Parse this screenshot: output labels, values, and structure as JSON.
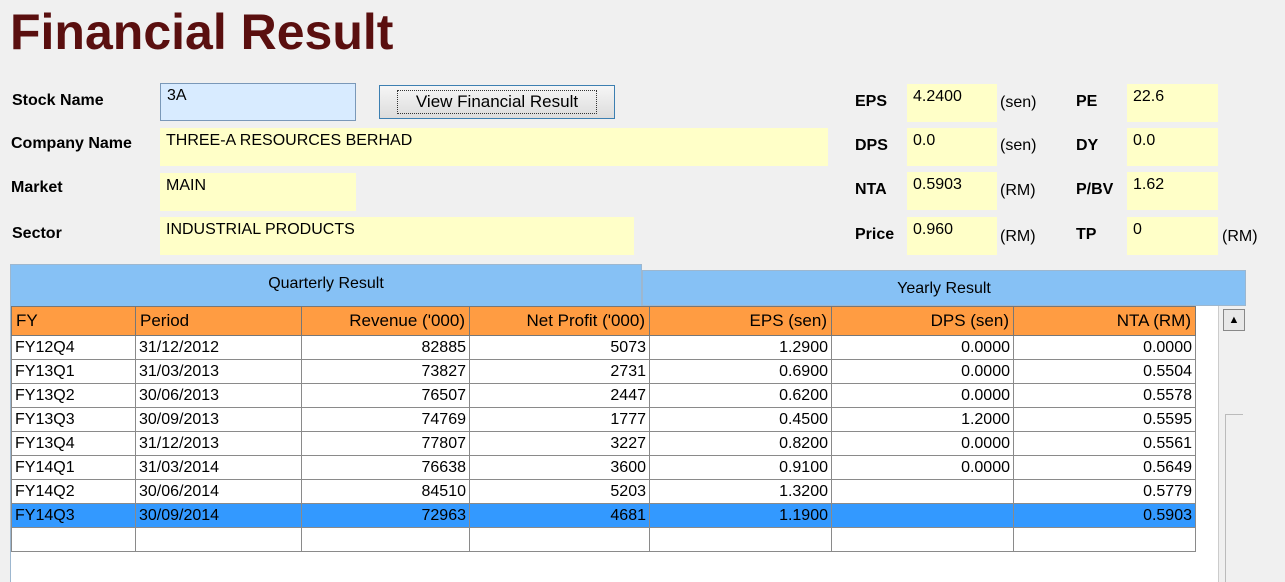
{
  "page": {
    "title": "Financial Result"
  },
  "form": {
    "stock_name_label": "Stock Name",
    "stock_name_value": "3A",
    "view_button": "View Financial Result",
    "company_name_label": "Company Name",
    "company_name_value": "THREE-A RESOURCES BERHAD",
    "market_label": "Market",
    "market_value": "MAIN",
    "sector_label": "Sector",
    "sector_value": "INDUSTRIAL PRODUCTS"
  },
  "metrics": {
    "eps_label": "EPS",
    "eps_value": "4.2400",
    "eps_unit": "(sen)",
    "dps_label": "DPS",
    "dps_value": "0.0",
    "dps_unit": "(sen)",
    "nta_label": "NTA",
    "nta_value": "0.5903",
    "nta_unit": "(RM)",
    "price_label": "Price",
    "price_value": "0.960",
    "price_unit": "(RM)",
    "pe_label": "PE",
    "pe_value": "22.6",
    "dy_label": "DY",
    "dy_value": "0.0",
    "pbv_label": "P/BV",
    "pbv_value": "1.62",
    "tp_label": "TP",
    "tp_value": "0",
    "tp_unit": "(RM)"
  },
  "tabs": {
    "quarterly": "Quarterly Result",
    "yearly": "Yearly Result"
  },
  "table": {
    "headers": [
      "FY",
      "Period",
      "Revenue ('000)",
      "Net Profit ('000)",
      "EPS (sen)",
      "DPS (sen)",
      "NTA (RM)"
    ],
    "rows": [
      [
        "FY12Q4",
        "31/12/2012",
        "82885",
        "5073",
        "1.2900",
        "0.0000",
        "0.0000"
      ],
      [
        "FY13Q1",
        "31/03/2013",
        "73827",
        "2731",
        "0.6900",
        "0.0000",
        "0.5504"
      ],
      [
        "FY13Q2",
        "30/06/2013",
        "76507",
        "2447",
        "0.6200",
        "0.0000",
        "0.5578"
      ],
      [
        "FY13Q3",
        "30/09/2013",
        "74769",
        "1777",
        "0.4500",
        "1.2000",
        "0.5595"
      ],
      [
        "FY13Q4",
        "31/12/2013",
        "77807",
        "3227",
        "0.8200",
        "0.0000",
        "0.5561"
      ],
      [
        "FY14Q1",
        "31/03/2014",
        "76638",
        "3600",
        "0.9100",
        "0.0000",
        "0.5649"
      ],
      [
        "FY14Q2",
        "30/06/2014",
        "84510",
        "5203",
        "1.3200",
        "",
        "0.5779"
      ],
      [
        "FY14Q3",
        "30/09/2014",
        "72963",
        "4681",
        "1.1900",
        "",
        "0.5903"
      ],
      [
        "",
        "",
        "",
        "",
        "",
        "",
        ""
      ]
    ],
    "selected_row": 7
  },
  "icons": {
    "scroll_up": "scroll-up-arrow-icon"
  },
  "colors": {
    "title": "#5a0f0f",
    "value_box": "#ffffc8",
    "header": "#ff9c42",
    "tab": "#86c1f5",
    "selection": "#3399ff"
  }
}
